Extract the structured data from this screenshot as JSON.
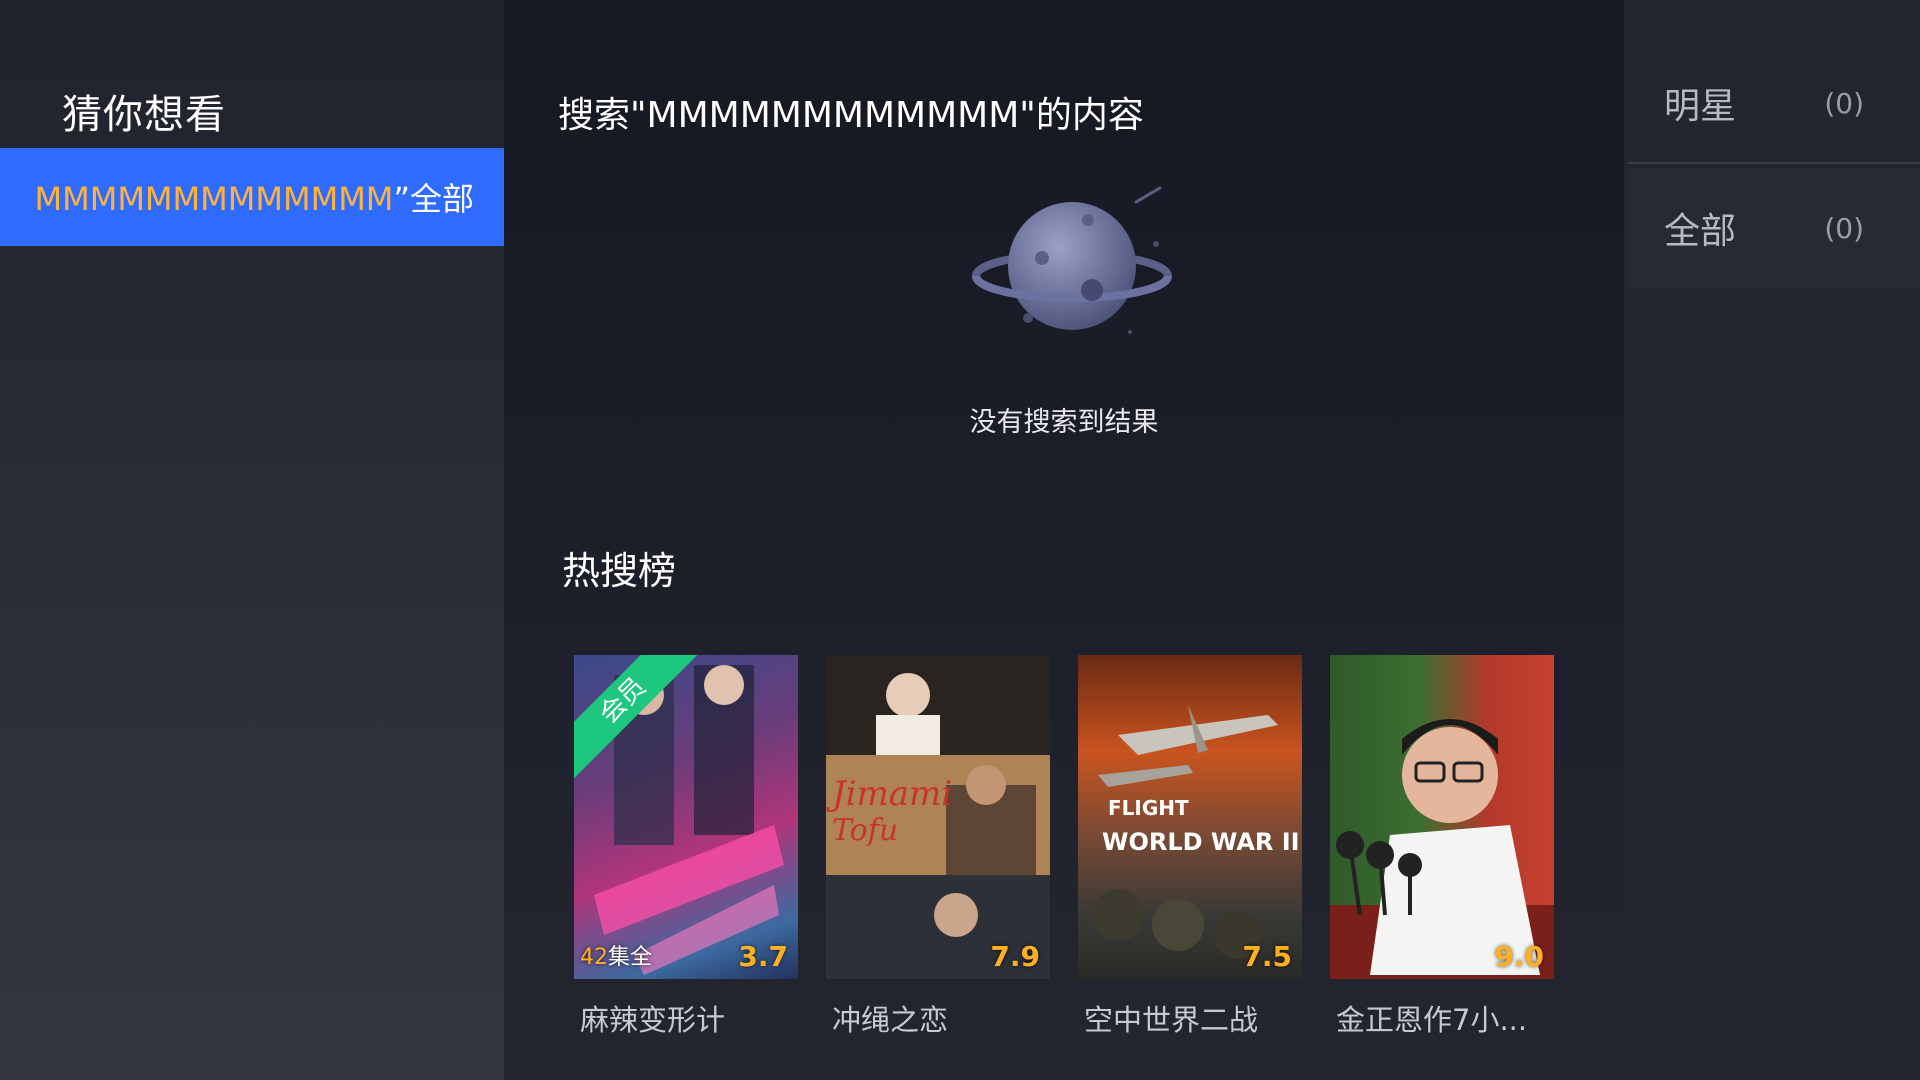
{
  "left_panel": {
    "title": "猜你想看",
    "suggestion": {
      "query": "MMMMMMMMMMMMM",
      "suffix": "”全部"
    }
  },
  "main": {
    "heading": "搜索\"MMMMMMMMMMMM\"的内容",
    "empty_message": "没有搜索到结果",
    "hot_title": "热搜榜",
    "cards": [
      {
        "title": "麻辣变形计",
        "rating": "3.7",
        "episodes_num": "42",
        "episodes_suffix": "集全",
        "badge": "会员"
      },
      {
        "title": "冲绳之恋",
        "rating": "7.9"
      },
      {
        "title": "空中世界二战",
        "rating": "7.5"
      },
      {
        "title": "金正恩作7小...",
        "rating": "9.0"
      }
    ]
  },
  "right_panel": {
    "filters": [
      {
        "label": "明星",
        "count": "(0)"
      },
      {
        "label": "全部",
        "count": "(0)"
      }
    ]
  },
  "colors": {
    "accent_blue": "#2f6bff",
    "highlight_orange": "#ffb33b",
    "rating_orange": "#ffb020",
    "vip_green": "#1ec77e"
  }
}
